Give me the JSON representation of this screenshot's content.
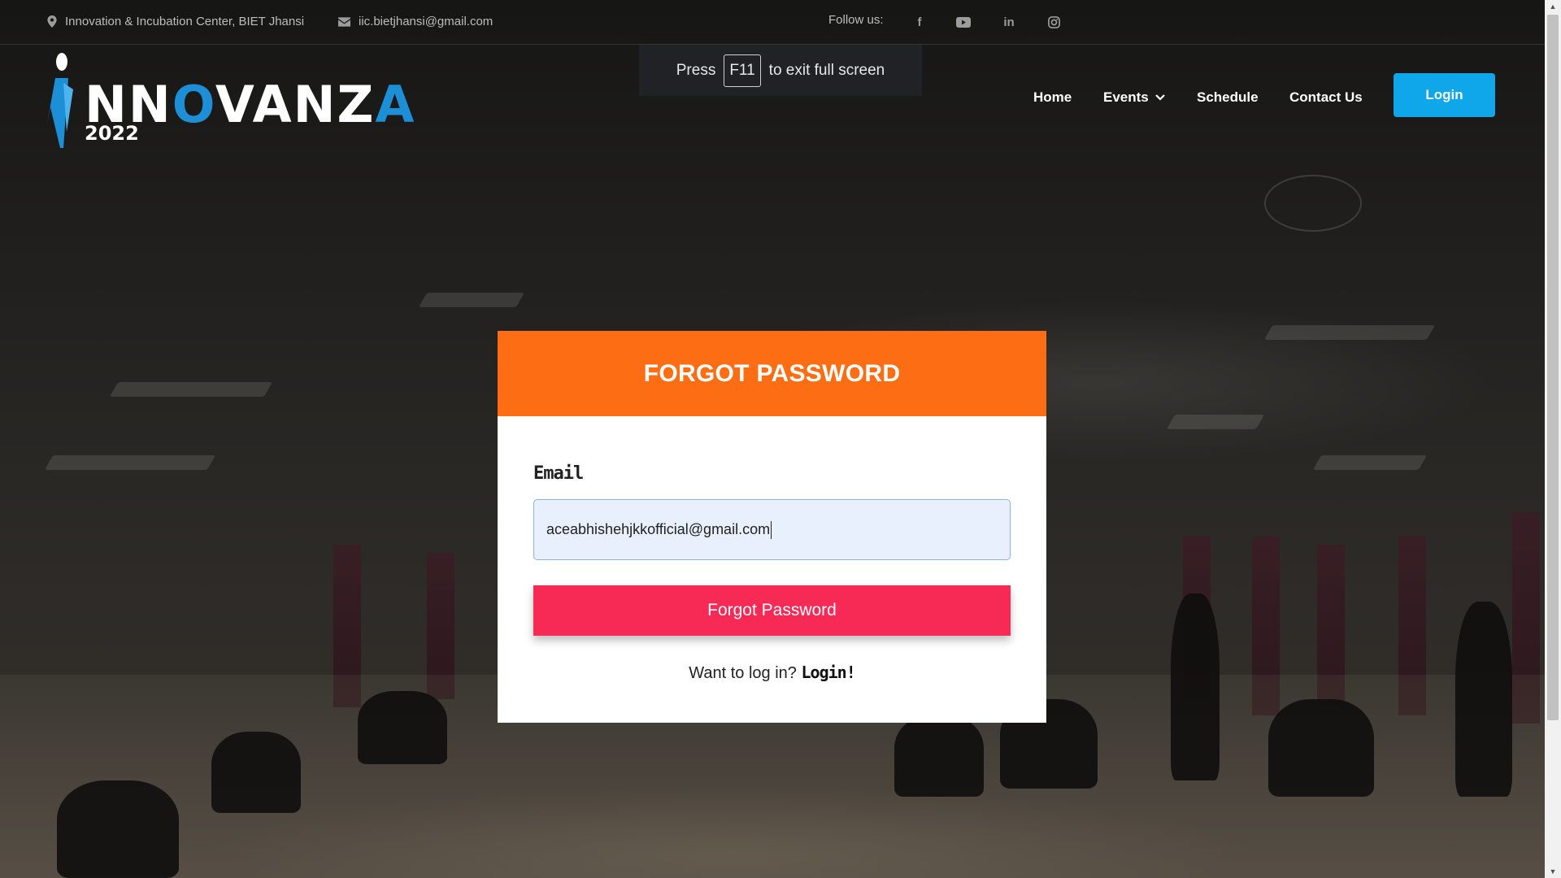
{
  "topbar": {
    "address": "Innovation & Incubation Center, BIET Jhansi",
    "email": "iic.bietjhansi@gmail.com",
    "follow_label": "Follow us:",
    "social": [
      "facebook-icon",
      "youtube-icon",
      "linkedin-icon",
      "instagram-icon"
    ]
  },
  "fullscreen_notice": {
    "press": "Press",
    "key": "F11",
    "rest": "to exit full screen"
  },
  "logo": {
    "word_white_1": "NN",
    "word_blue": "O",
    "word_white_2": "VANZ",
    "word_blue_2": "A",
    "year": "2022"
  },
  "nav": {
    "home": "Home",
    "events": "Events",
    "schedule": "Schedule",
    "contact": "Contact Us",
    "login": "Login"
  },
  "form": {
    "title": "FORGOT PASSWORD",
    "email_label": "Email",
    "email_value": "aceabhishehjkkofficial@gmail.com",
    "submit_label": "Forgot Password",
    "footer_prefix": "Want to log in?",
    "footer_link": "Login!"
  },
  "colors": {
    "accent_orange": "#fd6e14",
    "accent_pink": "#f62a55",
    "login_blue": "#0fa7ea"
  }
}
